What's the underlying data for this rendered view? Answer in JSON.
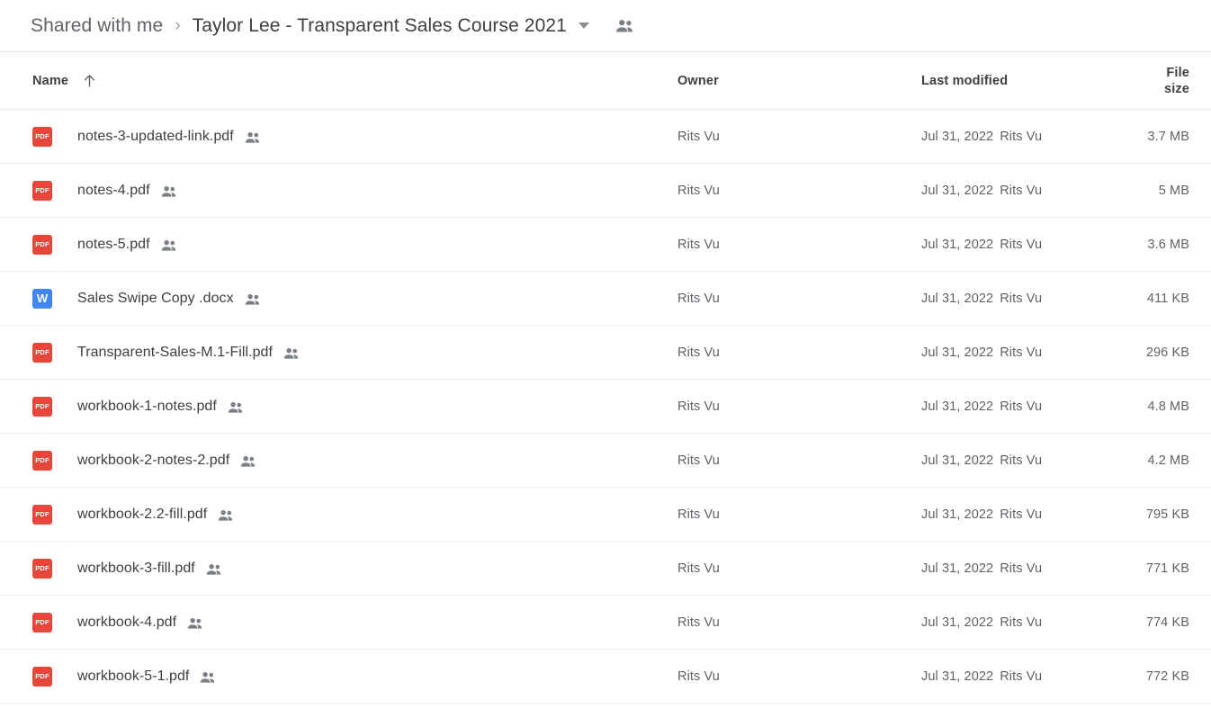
{
  "breadcrumb": {
    "parent": "Shared with me",
    "separator": "›",
    "current": "Taylor Lee - Transparent Sales Course 2021",
    "caret_icon": "chevron-down-icon",
    "people_icon": "people-shared-icon"
  },
  "columns": {
    "name": "Name",
    "owner": "Owner",
    "last_modified": "Last modified",
    "file_size": "File size",
    "sort_icon": "arrow-up-icon",
    "sort_direction": "ascending"
  },
  "colors": {
    "pdf_icon": "#e8453c",
    "docx_icon": "#4285f4",
    "text_primary": "#3c4043",
    "text_secondary": "#5f6368",
    "divider": "#eeeeee"
  },
  "files": [
    {
      "name": "notes-3-updated-link.pdf",
      "type": "pdf",
      "icon_label": "PDF",
      "shared": true,
      "owner": "Rits Vu",
      "modified_date": "Jul 31, 2022",
      "modified_by": "Rits Vu",
      "size": "3.7 MB"
    },
    {
      "name": "notes-4.pdf",
      "type": "pdf",
      "icon_label": "PDF",
      "shared": true,
      "owner": "Rits Vu",
      "modified_date": "Jul 31, 2022",
      "modified_by": "Rits Vu",
      "size": "5 MB"
    },
    {
      "name": "notes-5.pdf",
      "type": "pdf",
      "icon_label": "PDF",
      "shared": true,
      "owner": "Rits Vu",
      "modified_date": "Jul 31, 2022",
      "modified_by": "Rits Vu",
      "size": "3.6 MB"
    },
    {
      "name": "Sales Swipe Copy .docx",
      "type": "docx",
      "icon_label": "W",
      "shared": true,
      "owner": "Rits Vu",
      "modified_date": "Jul 31, 2022",
      "modified_by": "Rits Vu",
      "size": "411 KB"
    },
    {
      "name": "Transparent-Sales-M.1-Fill.pdf",
      "type": "pdf",
      "icon_label": "PDF",
      "shared": true,
      "owner": "Rits Vu",
      "modified_date": "Jul 31, 2022",
      "modified_by": "Rits Vu",
      "size": "296 KB"
    },
    {
      "name": "workbook-1-notes.pdf",
      "type": "pdf",
      "icon_label": "PDF",
      "shared": true,
      "owner": "Rits Vu",
      "modified_date": "Jul 31, 2022",
      "modified_by": "Rits Vu",
      "size": "4.8 MB"
    },
    {
      "name": "workbook-2-notes-2.pdf",
      "type": "pdf",
      "icon_label": "PDF",
      "shared": true,
      "owner": "Rits Vu",
      "modified_date": "Jul 31, 2022",
      "modified_by": "Rits Vu",
      "size": "4.2 MB"
    },
    {
      "name": "workbook-2.2-fill.pdf",
      "type": "pdf",
      "icon_label": "PDF",
      "shared": true,
      "owner": "Rits Vu",
      "modified_date": "Jul 31, 2022",
      "modified_by": "Rits Vu",
      "size": "795 KB"
    },
    {
      "name": "workbook-3-fill.pdf",
      "type": "pdf",
      "icon_label": "PDF",
      "shared": true,
      "owner": "Rits Vu",
      "modified_date": "Jul 31, 2022",
      "modified_by": "Rits Vu",
      "size": "771 KB"
    },
    {
      "name": "workbook-4.pdf",
      "type": "pdf",
      "icon_label": "PDF",
      "shared": true,
      "owner": "Rits Vu",
      "modified_date": "Jul 31, 2022",
      "modified_by": "Rits Vu",
      "size": "774 KB"
    },
    {
      "name": "workbook-5-1.pdf",
      "type": "pdf",
      "icon_label": "PDF",
      "shared": true,
      "owner": "Rits Vu",
      "modified_date": "Jul 31, 2022",
      "modified_by": "Rits Vu",
      "size": "772 KB"
    }
  ]
}
